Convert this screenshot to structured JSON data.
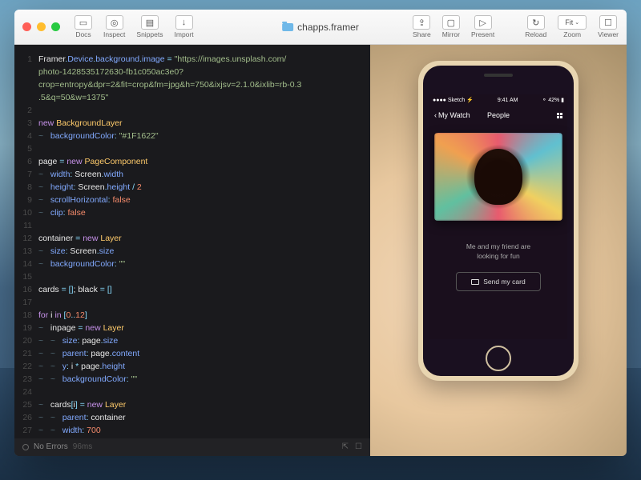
{
  "window": {
    "title": "chapps.framer"
  },
  "toolbar": {
    "left": [
      {
        "label": "Docs",
        "icon": "book"
      },
      {
        "label": "Inspect",
        "icon": "target"
      },
      {
        "label": "Snippets",
        "icon": "snippet"
      },
      {
        "label": "Import",
        "icon": "download"
      }
    ],
    "right": [
      {
        "label": "Share",
        "icon": "share"
      },
      {
        "label": "Mirror",
        "icon": "mirror"
      },
      {
        "label": "Present",
        "icon": "play"
      },
      {
        "label": "Reload",
        "icon": "reload"
      },
      {
        "label": "Zoom",
        "icon": "zoom",
        "value": "Fit"
      },
      {
        "label": "Viewer",
        "icon": "viewer"
      }
    ]
  },
  "code": {
    "lines": [
      {
        "n": "1",
        "tokens": [
          [
            "var",
            "Framer"
          ],
          [
            "op",
            "."
          ],
          [
            "prop",
            "Device"
          ],
          [
            "op",
            "."
          ],
          [
            "prop",
            "background"
          ],
          [
            "op",
            "."
          ],
          [
            "prop",
            "image"
          ],
          [
            "var",
            " "
          ],
          [
            "op",
            "="
          ],
          [
            "var",
            " "
          ],
          [
            "str",
            "\"https://images.unsplash.com/"
          ]
        ]
      },
      {
        "n": "",
        "tokens": [
          [
            "str",
            "photo-1428535172630-fb1c050ac3e0?"
          ]
        ]
      },
      {
        "n": "",
        "tokens": [
          [
            "str",
            "crop=entropy&dpr=2&fit=crop&fm=jpg&h=750&ixjsv=2.1.0&ixlib=rb-0.3"
          ]
        ]
      },
      {
        "n": "",
        "tokens": [
          [
            "str",
            ".5&q=50&w=1375\""
          ]
        ]
      },
      {
        "n": "2",
        "tokens": []
      },
      {
        "n": "3",
        "tokens": [
          [
            "key",
            "new"
          ],
          [
            "var",
            " "
          ],
          [
            "type",
            "BackgroundLayer"
          ]
        ]
      },
      {
        "n": "4",
        "tokens": [
          [
            "comment",
            "~   "
          ],
          [
            "prop",
            "backgroundColor"
          ],
          [
            "op",
            ": "
          ],
          [
            "str",
            "\"#1F1622\""
          ]
        ]
      },
      {
        "n": "5",
        "tokens": []
      },
      {
        "n": "6",
        "tokens": [
          [
            "var",
            "page "
          ],
          [
            "op",
            "="
          ],
          [
            "var",
            " "
          ],
          [
            "key",
            "new"
          ],
          [
            "var",
            " "
          ],
          [
            "type",
            "PageComponent"
          ]
        ]
      },
      {
        "n": "7",
        "tokens": [
          [
            "comment",
            "~   "
          ],
          [
            "prop",
            "width"
          ],
          [
            "op",
            ": "
          ],
          [
            "var",
            "Screen"
          ],
          [
            "op",
            "."
          ],
          [
            "prop",
            "width"
          ]
        ]
      },
      {
        "n": "8",
        "tokens": [
          [
            "comment",
            "~   "
          ],
          [
            "prop",
            "height"
          ],
          [
            "op",
            ": "
          ],
          [
            "var",
            "Screen"
          ],
          [
            "op",
            "."
          ],
          [
            "prop",
            "height"
          ],
          [
            "var",
            " "
          ],
          [
            "op",
            "/"
          ],
          [
            "var",
            " "
          ],
          [
            "num",
            "2"
          ]
        ]
      },
      {
        "n": "9",
        "tokens": [
          [
            "comment",
            "~   "
          ],
          [
            "prop",
            "scrollHorizontal"
          ],
          [
            "op",
            ": "
          ],
          [
            "bool",
            "false"
          ]
        ]
      },
      {
        "n": "10",
        "tokens": [
          [
            "comment",
            "~   "
          ],
          [
            "prop",
            "clip"
          ],
          [
            "op",
            ": "
          ],
          [
            "bool",
            "false"
          ]
        ]
      },
      {
        "n": "11",
        "tokens": []
      },
      {
        "n": "12",
        "tokens": [
          [
            "var",
            "container "
          ],
          [
            "op",
            "="
          ],
          [
            "var",
            " "
          ],
          [
            "key",
            "new"
          ],
          [
            "var",
            " "
          ],
          [
            "type",
            "Layer"
          ]
        ]
      },
      {
        "n": "13",
        "tokens": [
          [
            "comment",
            "~   "
          ],
          [
            "prop",
            "size"
          ],
          [
            "op",
            ": "
          ],
          [
            "var",
            "Screen"
          ],
          [
            "op",
            "."
          ],
          [
            "prop",
            "size"
          ]
        ]
      },
      {
        "n": "14",
        "tokens": [
          [
            "comment",
            "~   "
          ],
          [
            "prop",
            "backgroundColor"
          ],
          [
            "op",
            ": "
          ],
          [
            "str",
            "\"\""
          ]
        ]
      },
      {
        "n": "15",
        "tokens": []
      },
      {
        "n": "16",
        "tokens": [
          [
            "var",
            "cards "
          ],
          [
            "op",
            "="
          ],
          [
            "var",
            " "
          ],
          [
            "op",
            "[]"
          ],
          [
            "var",
            "; black "
          ],
          [
            "op",
            "="
          ],
          [
            "var",
            " "
          ],
          [
            "op",
            "[]"
          ]
        ]
      },
      {
        "n": "17",
        "tokens": []
      },
      {
        "n": "18",
        "tokens": [
          [
            "key",
            "for"
          ],
          [
            "var",
            " i "
          ],
          [
            "key",
            "in"
          ],
          [
            "var",
            " "
          ],
          [
            "op",
            "["
          ],
          [
            "num",
            "0"
          ],
          [
            "op",
            ".."
          ],
          [
            "num",
            "12"
          ],
          [
            "op",
            "]"
          ]
        ]
      },
      {
        "n": "19",
        "tokens": [
          [
            "comment",
            "~   "
          ],
          [
            "var",
            "inpage "
          ],
          [
            "op",
            "="
          ],
          [
            "var",
            " "
          ],
          [
            "key",
            "new"
          ],
          [
            "var",
            " "
          ],
          [
            "type",
            "Layer"
          ]
        ]
      },
      {
        "n": "20",
        "tokens": [
          [
            "comment",
            "~   ~   "
          ],
          [
            "prop",
            "size"
          ],
          [
            "op",
            ": "
          ],
          [
            "var",
            "page"
          ],
          [
            "op",
            "."
          ],
          [
            "prop",
            "size"
          ]
        ]
      },
      {
        "n": "21",
        "tokens": [
          [
            "comment",
            "~   ~   "
          ],
          [
            "prop",
            "parent"
          ],
          [
            "op",
            ": "
          ],
          [
            "var",
            "page"
          ],
          [
            "op",
            "."
          ],
          [
            "prop",
            "content"
          ]
        ]
      },
      {
        "n": "22",
        "tokens": [
          [
            "comment",
            "~   ~   "
          ],
          [
            "prop",
            "y"
          ],
          [
            "op",
            ": "
          ],
          [
            "var",
            "i "
          ],
          [
            "op",
            "*"
          ],
          [
            "var",
            " page"
          ],
          [
            "op",
            "."
          ],
          [
            "prop",
            "height"
          ]
        ]
      },
      {
        "n": "23",
        "tokens": [
          [
            "comment",
            "~   ~   "
          ],
          [
            "prop",
            "backgroundColor"
          ],
          [
            "op",
            ": "
          ],
          [
            "str",
            "\"\""
          ]
        ]
      },
      {
        "n": "24",
        "tokens": []
      },
      {
        "n": "25",
        "tokens": [
          [
            "comment",
            "~   "
          ],
          [
            "var",
            "cards"
          ],
          [
            "op",
            "["
          ],
          [
            "var",
            "i"
          ],
          [
            "op",
            "]"
          ],
          [
            "var",
            " "
          ],
          [
            "op",
            "="
          ],
          [
            "var",
            " "
          ],
          [
            "key",
            "new"
          ],
          [
            "var",
            " "
          ],
          [
            "type",
            "Layer"
          ]
        ]
      },
      {
        "n": "26",
        "tokens": [
          [
            "comment",
            "~   ~   "
          ],
          [
            "prop",
            "parent"
          ],
          [
            "op",
            ": "
          ],
          [
            "var",
            "container"
          ]
        ]
      },
      {
        "n": "27",
        "tokens": [
          [
            "comment",
            "~   ~   "
          ],
          [
            "prop",
            "width"
          ],
          [
            "op",
            ": "
          ],
          [
            "num",
            "700"
          ]
        ]
      }
    ]
  },
  "status": {
    "errors": "No Errors",
    "time": "96ms"
  },
  "phone": {
    "carrier": "Sketch",
    "time": "9:41 AM",
    "battery": "42%",
    "back": "My Watch",
    "title": "People",
    "caption1": "Me and my friend are",
    "caption2": "looking for fun",
    "button": "Send my card"
  }
}
